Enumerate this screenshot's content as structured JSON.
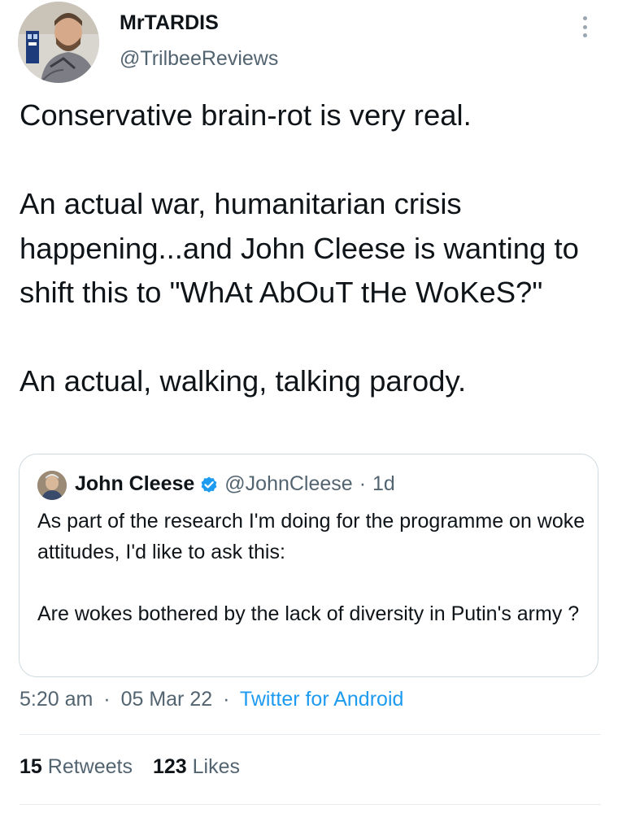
{
  "author": {
    "name": "MrTARDIS",
    "handle": "@TrilbeeReviews",
    "avatar_icon": "profile-photo-avatar"
  },
  "more_icon": "vertical-ellipsis-icon",
  "tweet": {
    "text": "Conservative brain-rot is very real.\n\nAn actual war, humanitarian crisis happening...and John Cleese is wanting to shift this to \"WhAt AbOuT tHe WoKeS?\"\n\nAn actual, walking, talking parody."
  },
  "quoted_tweet": {
    "name": "John Cleese",
    "verified_icon": "verified-badge-icon",
    "handle": "@JohnCleese",
    "separator": "·",
    "age": "1d",
    "text": "As part of the research I'm doing for the programme on woke attitudes, I'd like to ask this:\n\nAre wokes bothered by the lack of diversity in Putin's army ?"
  },
  "meta": {
    "time": "5:20 am",
    "sep1": "·",
    "date": "05 Mar 22",
    "sep2": "·",
    "source": "Twitter for Android"
  },
  "stats": {
    "retweets_count": "15",
    "retweets_label": "Retweets",
    "likes_count": "123",
    "likes_label": "Likes"
  },
  "colors": {
    "text": "#0f1419",
    "secondary": "#536471",
    "link": "#1d9bf0",
    "border": "#cfd9de"
  }
}
